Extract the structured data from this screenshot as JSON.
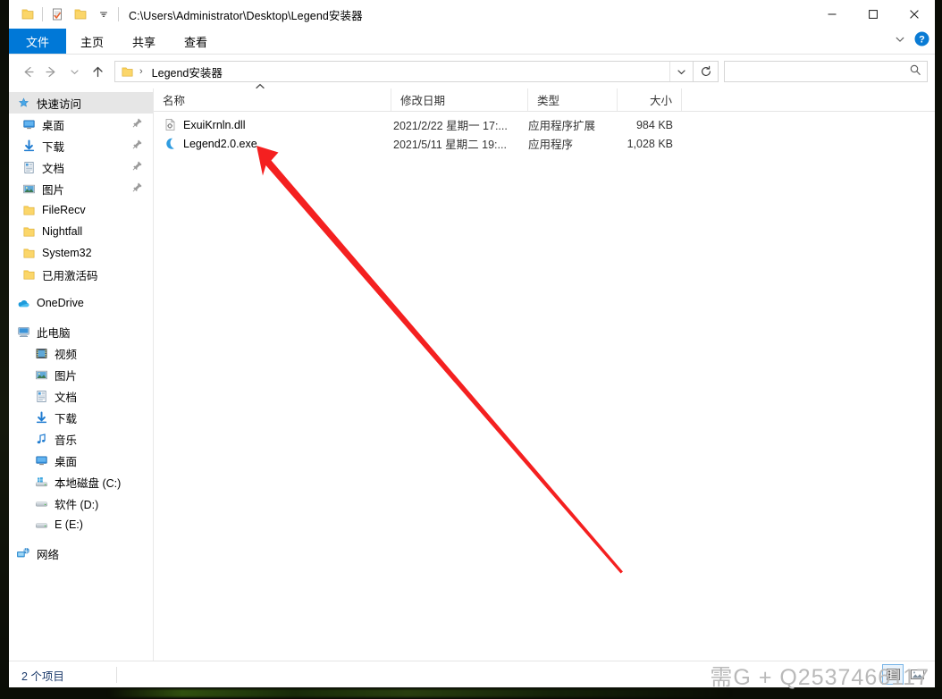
{
  "window": {
    "title_path": "C:\\Users\\Administrator\\Desktop\\Legend安装器",
    "minimize_label": "—",
    "maximize_label": "▢",
    "close_label": "✕"
  },
  "quick_access_toolbar": {
    "folder_icon": "folder-icon",
    "properties_icon": "properties-icon",
    "new_folder_icon": "new-folder-icon",
    "customize_icon": "chevron-down-icon"
  },
  "ribbon": {
    "tabs": [
      {
        "label": "文件",
        "active": true
      },
      {
        "label": "主页",
        "active": false
      },
      {
        "label": "共享",
        "active": false
      },
      {
        "label": "查看",
        "active": false
      }
    ],
    "expand_icon": "chevron-down-icon",
    "help_icon": "help-icon"
  },
  "navbar": {
    "back_icon": "back-arrow-icon",
    "forward_icon": "forward-arrow-icon",
    "recent_icon": "chevron-down-icon",
    "up_icon": "up-arrow-icon",
    "breadcrumb": {
      "folder_icon": "folder-icon",
      "text": "Legend安装器",
      "separator": "›"
    },
    "address_dropdown_icon": "chevron-down-icon",
    "refresh_icon": "refresh-icon",
    "search": {
      "value": "",
      "placeholder": "",
      "icon": "search-icon"
    }
  },
  "sidebar": {
    "items": [
      {
        "label": "快速访问",
        "icon": "pin-star-icon",
        "level": 0,
        "selected": true,
        "pinned": false
      },
      {
        "label": "桌面",
        "icon": "desktop-icon",
        "level": 1,
        "selected": false,
        "pinned": true
      },
      {
        "label": "下载",
        "icon": "download-icon",
        "level": 1,
        "selected": false,
        "pinned": true
      },
      {
        "label": "文档",
        "icon": "documents-icon",
        "level": 1,
        "selected": false,
        "pinned": true
      },
      {
        "label": "图片",
        "icon": "pictures-icon",
        "level": 1,
        "selected": false,
        "pinned": true
      },
      {
        "label": "FileRecv",
        "icon": "folder-icon",
        "level": 1,
        "selected": false,
        "pinned": false
      },
      {
        "label": "Nightfall",
        "icon": "folder-icon",
        "level": 1,
        "selected": false,
        "pinned": false
      },
      {
        "label": "System32",
        "icon": "folder-icon",
        "level": 1,
        "selected": false,
        "pinned": false
      },
      {
        "label": "已用激活码",
        "icon": "folder-icon",
        "level": 1,
        "selected": false,
        "pinned": false
      },
      {
        "label": "OneDrive",
        "icon": "onedrive-cloud-icon",
        "level": 0,
        "selected": false,
        "pinned": false,
        "gap_before": true
      },
      {
        "label": "此电脑",
        "icon": "this-pc-icon",
        "level": 0,
        "selected": false,
        "pinned": false,
        "gap_before": true
      },
      {
        "label": "视频",
        "icon": "videos-icon",
        "level": 1,
        "selected": false,
        "pinned": false
      },
      {
        "label": "图片",
        "icon": "pictures-icon",
        "level": 1,
        "selected": false,
        "pinned": false
      },
      {
        "label": "文档",
        "icon": "documents-icon",
        "level": 1,
        "selected": false,
        "pinned": false
      },
      {
        "label": "下载",
        "icon": "download-icon",
        "level": 1,
        "selected": false,
        "pinned": false
      },
      {
        "label": "音乐",
        "icon": "music-icon",
        "level": 1,
        "selected": false,
        "pinned": false
      },
      {
        "label": "桌面",
        "icon": "desktop-icon",
        "level": 1,
        "selected": false,
        "pinned": false
      },
      {
        "label": "本地磁盘 (C:)",
        "icon": "windows-drive-icon",
        "level": 1,
        "selected": false,
        "pinned": false
      },
      {
        "label": "软件 (D:)",
        "icon": "drive-icon",
        "level": 1,
        "selected": false,
        "pinned": false
      },
      {
        "label": "E (E:)",
        "icon": "drive-icon",
        "level": 1,
        "selected": false,
        "pinned": false
      },
      {
        "label": "网络",
        "icon": "network-icon",
        "level": 0,
        "selected": false,
        "pinned": false,
        "gap_before": true
      }
    ]
  },
  "file_list": {
    "columns": [
      {
        "label": "名称",
        "key": "name",
        "sorted": "asc"
      },
      {
        "label": "修改日期",
        "key": "date",
        "sorted": ""
      },
      {
        "label": "类型",
        "key": "type",
        "sorted": ""
      },
      {
        "label": "大小",
        "key": "size",
        "sorted": ""
      }
    ],
    "rows": [
      {
        "name": "ExuiKrnln.dll",
        "date": "2021/2/22 星期一 17:...",
        "type": "应用程序扩展",
        "size": "984 KB",
        "icon": "dll-file-icon"
      },
      {
        "name": "Legend2.0.exe",
        "date": "2021/5/11 星期二 19:...",
        "type": "应用程序",
        "size": "1,028 KB",
        "icon": "moon-app-icon"
      }
    ]
  },
  "statusbar": {
    "item_count_text": "2 个项目",
    "details_view_icon": "details-view-icon",
    "large_icons_view_icon": "large-icons-view-icon",
    "active_view": "details"
  },
  "watermark": {
    "text": "需G + Q2537466117"
  },
  "annotation": {
    "type": "arrow",
    "color": "#f42020",
    "description": "red arrow pointing at Legend2.0.exe"
  },
  "colors": {
    "accent": "#0078d7",
    "selection": "#e6e6e6",
    "status_text": "#1b3a6b",
    "annotation_red": "#f42020",
    "folder_yellow": "#fbd66a"
  }
}
